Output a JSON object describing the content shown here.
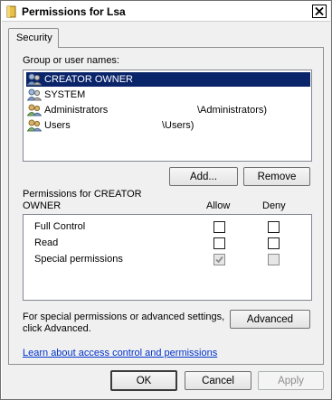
{
  "window": {
    "title": "Permissions for Lsa"
  },
  "tabs": [
    {
      "label": "Security"
    }
  ],
  "group_section": {
    "label": "Group or user names:",
    "items": [
      {
        "name": "CREATOR OWNER",
        "extra": "",
        "selected": true
      },
      {
        "name": "SYSTEM",
        "extra": "",
        "selected": false
      },
      {
        "name": "Administrators",
        "extra": "\\Administrators)",
        "selected": false
      },
      {
        "name": "Users",
        "extra": "\\Users)",
        "selected": false
      }
    ],
    "add_button": "Add...",
    "remove_button": "Remove"
  },
  "permissions": {
    "label_line1": "Permissions for CREATOR",
    "label_line2": "OWNER",
    "allow_header": "Allow",
    "deny_header": "Deny",
    "rows": [
      {
        "name": "Full Control",
        "allow": false,
        "deny": false
      },
      {
        "name": "Read",
        "allow": false,
        "deny": false
      },
      {
        "name": "Special permissions",
        "allow": true,
        "deny": false
      }
    ]
  },
  "advanced": {
    "text_line1": "For special permissions or advanced settings,",
    "text_line2": "click Advanced.",
    "button": "Advanced"
  },
  "help_link": "Learn about access control and permissions",
  "footer": {
    "ok": "OK",
    "cancel": "Cancel",
    "apply": "Apply"
  }
}
